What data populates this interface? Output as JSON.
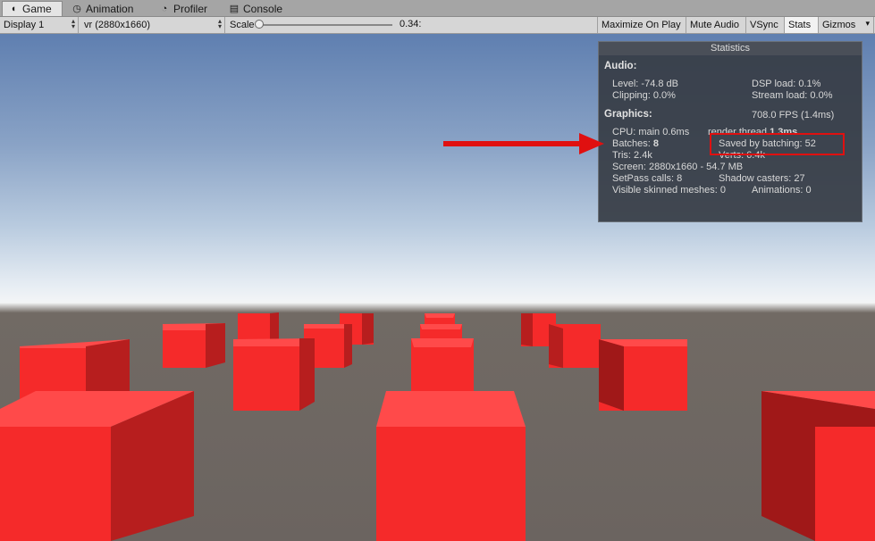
{
  "tabs": [
    {
      "label": "Game",
      "icon": "pacman-icon"
    },
    {
      "label": "Animation",
      "icon": "clock-icon"
    },
    {
      "label": "Profiler",
      "icon": "profiler-icon"
    },
    {
      "label": "Console",
      "icon": "console-icon"
    }
  ],
  "toolbar": {
    "display": "Display 1",
    "resolution": "vr (2880x1660)",
    "scale_label": "Scale",
    "scale_value": "0.34:",
    "maximize": "Maximize On Play",
    "mute": "Mute Audio",
    "vsync": "VSync",
    "stats": "Stats",
    "gizmos": "Gizmos"
  },
  "stats": {
    "title": "Statistics",
    "audio_header": "Audio:",
    "level": "Level: -74.8 dB",
    "dsp": "DSP load: 0.1%",
    "clipping": "Clipping: 0.0%",
    "stream": "Stream load: 0.0%",
    "graphics_header": "Graphics:",
    "fps": "708.0 FPS (1.4ms)",
    "cpu_main": "CPU: main 0.6ms",
    "render_thread_label": "render thread",
    "render_thread_value": "1.3ms",
    "batches_label": "Batches:",
    "batches_value": "8",
    "saved_batching": "Saved by batching: 52",
    "tris": "Tris: 2.4k",
    "verts": "Verts: 6.4k",
    "screen": "Screen: 2880x1660 - 54.7 MB",
    "setpass": "SetPass calls: 8",
    "shadow": "Shadow casters: 27",
    "skinned": "Visible skinned meshes: 0",
    "animations": "Animations: 0"
  },
  "colors": {
    "highlight": "#e01010",
    "cube_front": "#f52a2a",
    "cube_side": "#b71e1e",
    "cube_top": "#ff4a4a"
  }
}
